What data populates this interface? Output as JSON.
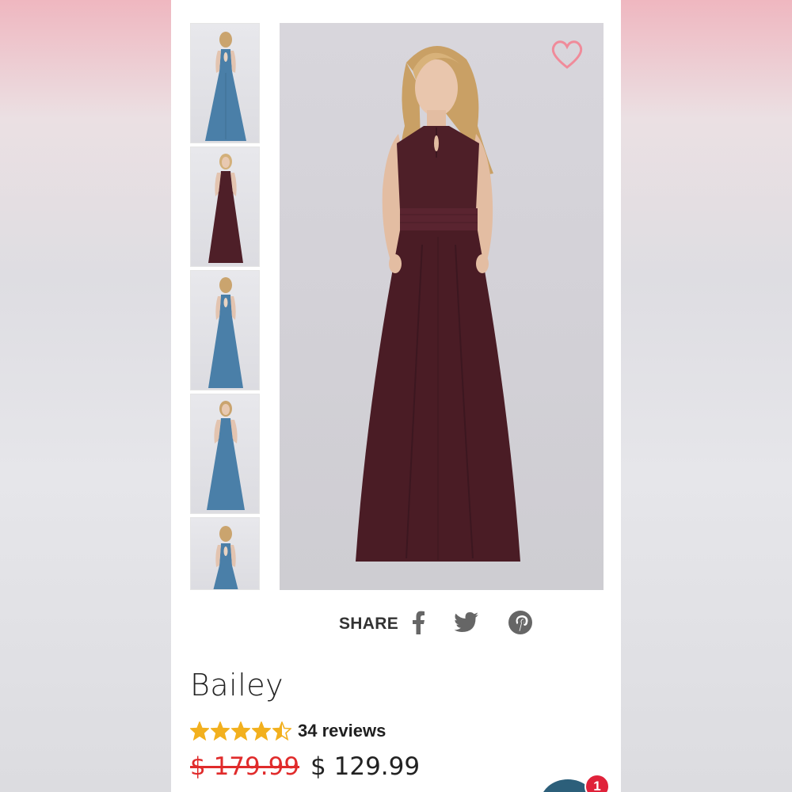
{
  "product": {
    "name": "Bailey",
    "review_count_label": "34 reviews",
    "rating": 4.5,
    "rating_max": 5,
    "original_price": "$ 179.99",
    "sale_price": "$ 129.99"
  },
  "share": {
    "label": "SHARE",
    "icons": [
      "facebook-icon",
      "twitter-icon",
      "pinterest-icon"
    ]
  },
  "gallery": {
    "thumbnails": [
      {
        "view": "back",
        "color": "steel blue"
      },
      {
        "view": "front",
        "color": "wine"
      },
      {
        "view": "back",
        "color": "steel blue"
      },
      {
        "view": "front",
        "color": "steel blue"
      },
      {
        "view": "back",
        "color": "steel blue"
      }
    ],
    "main_color": "wine"
  },
  "chat": {
    "badge_count": "1"
  },
  "colors": {
    "star": "#f2b01e",
    "strike_price": "#e02b2b",
    "heart": "#f08b9a",
    "wine": "#4e1f28",
    "steel_blue": "#4a7fa8",
    "chat": "#2c5f7a",
    "badge": "#e0223a"
  }
}
